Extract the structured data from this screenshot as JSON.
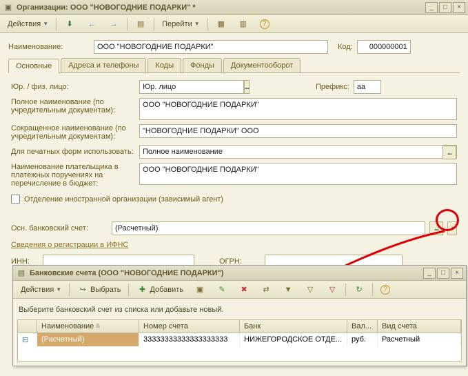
{
  "main_window": {
    "title": "Организации: ООО \"НОВОГОДНИЕ ПОДАРКИ\" *",
    "toolbar": {
      "actions": "Действия",
      "goto": "Перейти"
    },
    "name_label": "Наименование:",
    "name_value": "ООО \"НОВОГОДНИЕ ПОДАРКИ\"",
    "code_label": "Код:",
    "code_value": "000000001",
    "tabs": [
      "Основные",
      "Адреса и телефоны",
      "Коды",
      "Фонды",
      "Документооборот"
    ],
    "type_label": "Юр. / физ. лицо:",
    "type_value": "Юр. лицо",
    "prefix_label": "Префикс:",
    "prefix_value": "аа",
    "full_name_label": "Полное наименование (по учредительным документам):",
    "full_name_value": "ООО \"НОВОГОДНИЕ ПОДАРКИ\"",
    "short_name_label": "Сокращенное наименование (по учредительным документам):",
    "short_name_value": "\"НОВОГОДНИЕ ПОДАРКИ\" ООО",
    "print_label": "Для печатных форм использовать:",
    "print_value": "Полное наименование",
    "payer_label": "Наименование плательщика в платежных поручениях на перечисление в бюджет:",
    "payer_value": "ООО \"НОВОГОДНИЕ ПОДАРКИ\"",
    "foreign_checkbox": "Отделение иностранной организации (зависимый агент)",
    "bank_label": "Осн. банковский счет:",
    "bank_value": "(Расчетный)",
    "ifns_title": "Сведения о регистрации в ИФНС",
    "inn_label": "ИНН:",
    "ogrn_label": "ОГРН:"
  },
  "inner_window": {
    "title": "Банковские счета (ООО \"НОВОГОДНИЕ ПОДАРКИ\")",
    "toolbar": {
      "actions": "Действия",
      "select": "Выбрать",
      "add": "Добавить"
    },
    "helper": "Выберите банковский счет из списка или добавьте новый.",
    "columns": [
      "",
      "Наименование",
      "Номер счета",
      "Банк",
      "Вал...",
      "Вид счета"
    ],
    "row": {
      "name": "(Расчетный)",
      "number": "33333333333333333333",
      "bank": "НИЖЕГОРОДСКОЕ ОТДЕ...",
      "currency": "руб.",
      "type": "Расчетный"
    }
  }
}
